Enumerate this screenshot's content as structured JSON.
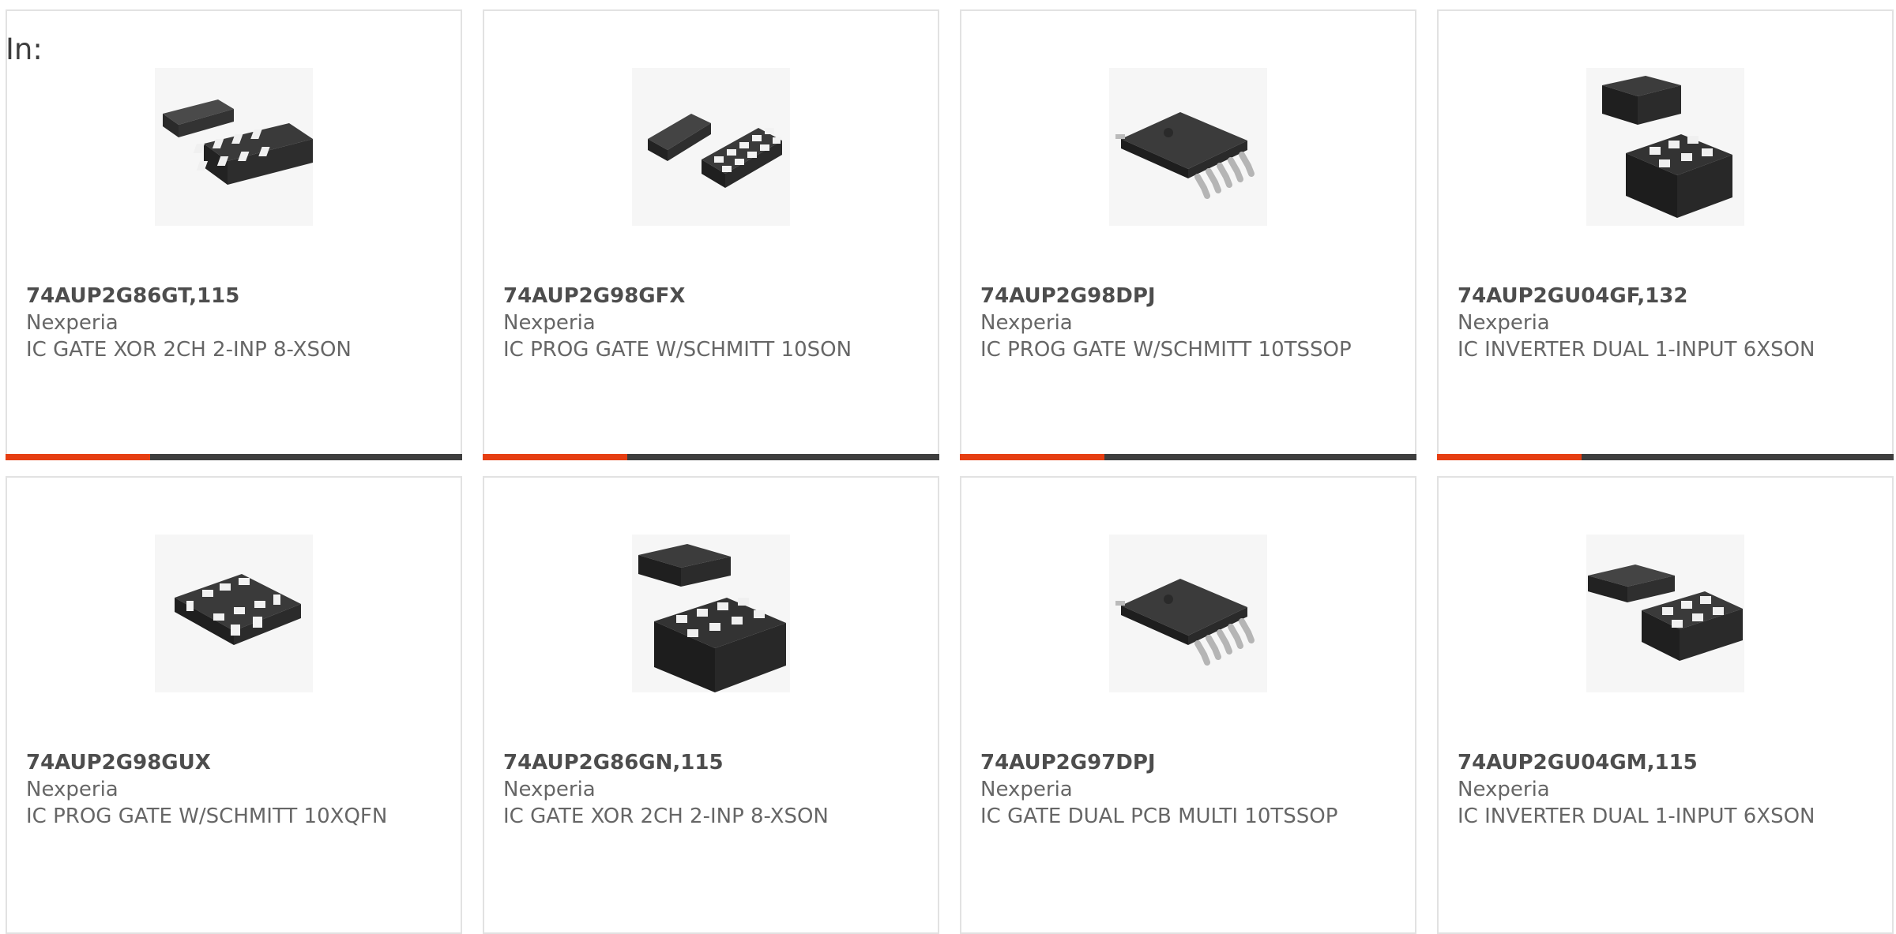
{
  "prefix_label": "In:",
  "products": [
    {
      "part_number": "74AUP2G86GT,115",
      "manufacturer": "Nexperia",
      "description": "IC GATE XOR 2CH 2-INP 8-XSON",
      "image_icon": "xson-package-image"
    },
    {
      "part_number": "74AUP2G98GFX",
      "manufacturer": "Nexperia",
      "description": "IC PROG GATE W/SCHMITT 10SON",
      "image_icon": "son-package-image"
    },
    {
      "part_number": "74AUP2G98DPJ",
      "manufacturer": "Nexperia",
      "description": "IC PROG GATE W/SCHMITT 10TSSOP",
      "image_icon": "tssop-package-image"
    },
    {
      "part_number": "74AUP2GU04GF,132",
      "manufacturer": "Nexperia",
      "description": "IC INVERTER DUAL 1-INPUT 6XSON",
      "image_icon": "xson-package-image"
    },
    {
      "part_number": "74AUP2G98GUX",
      "manufacturer": "Nexperia",
      "description": "IC PROG GATE W/SCHMITT 10XQFN",
      "image_icon": "xqfn-package-image"
    },
    {
      "part_number": "74AUP2G86GN,115",
      "manufacturer": "Nexperia",
      "description": "IC GATE XOR 2CH 2-INP 8-XSON",
      "image_icon": "xson-package-image"
    },
    {
      "part_number": "74AUP2G97DPJ",
      "manufacturer": "Nexperia",
      "description": "IC GATE DUAL PCB MULTI 10TSSOP",
      "image_icon": "tssop-package-image"
    },
    {
      "part_number": "74AUP2GU04GM,115",
      "manufacturer": "Nexperia",
      "description": "IC INVERTER DUAL 1-INPUT 6XSON",
      "image_icon": "xson-package-image"
    }
  ],
  "colors": {
    "accent": "#e63e12",
    "bar": "#3e3e3e",
    "border": "#e2e2e2"
  }
}
